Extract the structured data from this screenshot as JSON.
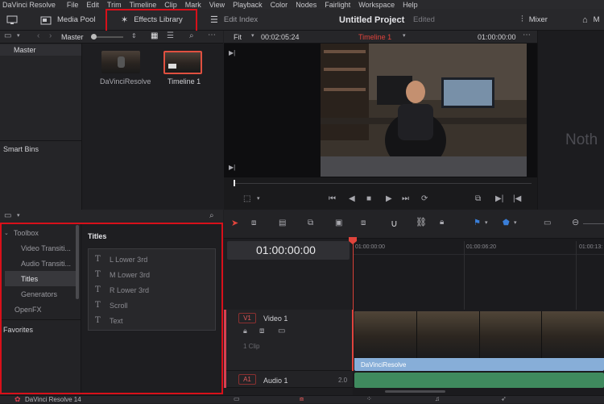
{
  "menubar": {
    "items": [
      "DaVinci Resolve",
      "File",
      "Edit",
      "Trim",
      "Timeline",
      "Clip",
      "Mark",
      "View",
      "Playback",
      "Color",
      "Nodes",
      "Fairlight",
      "Workspace",
      "Help"
    ]
  },
  "toolbar": {
    "media_pool": "Media Pool",
    "effects_library": "Effects Library",
    "edit_index": "Edit Index",
    "project_title": "Untitled Project",
    "project_status": "Edited",
    "mixer": "Mixer",
    "metadata_partial": "M"
  },
  "media_pool": {
    "folder_label": "Master",
    "bins": [
      "Master"
    ],
    "smart_bins_label": "Smart Bins",
    "clips": [
      {
        "name": "DaVinciResolve"
      },
      {
        "name": "Timeline 1"
      }
    ]
  },
  "viewer": {
    "zoom": "Fit",
    "source_timecode": "00:02:05:24",
    "timeline_name": "Timeline 1",
    "record_timecode": "01:00:00:00",
    "inspector_partial": "Noth"
  },
  "effects": {
    "sidebar": [
      {
        "label": "Toolbox",
        "level": 0,
        "expanded": true
      },
      {
        "label": "Video Transiti...",
        "level": 1
      },
      {
        "label": "Audio Transiti...",
        "level": 1
      },
      {
        "label": "Titles",
        "level": 1,
        "selected": true
      },
      {
        "label": "Generators",
        "level": 1
      },
      {
        "label": "OpenFX",
        "level": 0
      },
      {
        "label": "Favorites",
        "level": 0
      }
    ],
    "section_title": "Titles",
    "titles": [
      "L Lower 3rd",
      "M Lower 3rd",
      "R Lower 3rd",
      "Scroll",
      "Text"
    ]
  },
  "timeline": {
    "timecode": "01:00:00:00",
    "ruler": [
      "01:00:00:00",
      "01:00:06:20",
      "01:00:13:"
    ],
    "video_track": {
      "id": "V1",
      "name": "Video 1",
      "clip_count": "1 Clip"
    },
    "audio_track": {
      "id": "A1",
      "name": "Audio 1",
      "level": "2.0"
    },
    "clip_name": "DaVinciResolve"
  },
  "footer": {
    "app": "DaVinci Resolve 14"
  },
  "colors": {
    "accent_red": "#d8101a",
    "playhead": "#e0443c",
    "video_clip": "#87aed8",
    "audio_clip": "#3f8a5e",
    "timeline_name": "#e0443c"
  }
}
